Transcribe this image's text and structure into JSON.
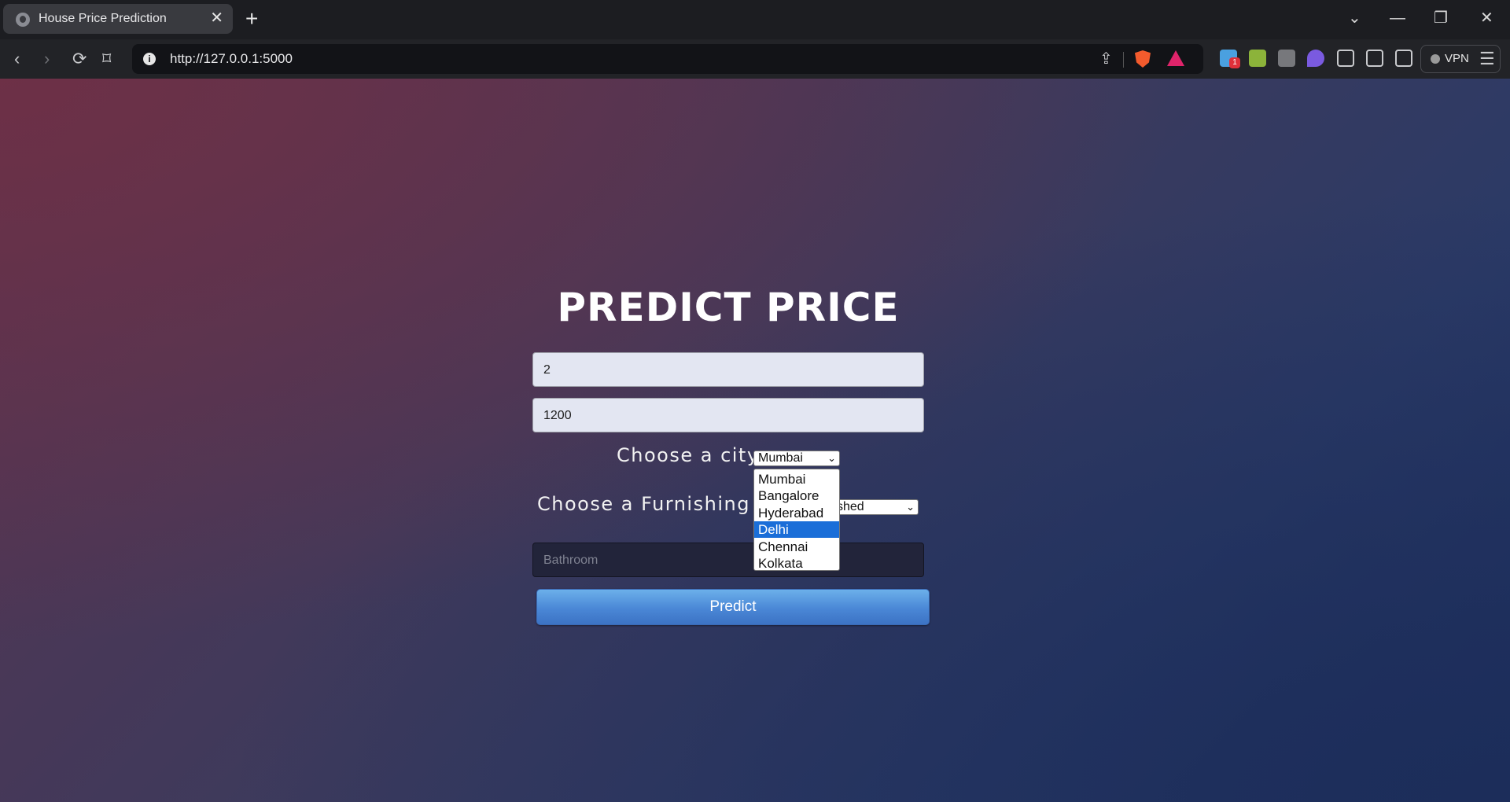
{
  "browser": {
    "tab_title": "House Price Prediction",
    "tab_close": "✕",
    "new_tab": "+",
    "url": "http://127.0.0.1:5000",
    "vpn_label": "VPN",
    "window_controls": [
      "⌄",
      "—",
      "❐",
      "✕"
    ],
    "nav": {
      "back": "‹",
      "forward": "›",
      "reload": "⟳",
      "bookmark": "⌑"
    },
    "extension_badge": "1"
  },
  "page": {
    "heading": "PREDICT PRICE",
    "bhk_value": "2",
    "area_value": "1200",
    "city_label": "Choose a city:",
    "city_selected": "Mumbai",
    "city_options": [
      "Mumbai",
      "Bangalore",
      "Hyderabad",
      "Delhi",
      "Chennai",
      "Kolkata"
    ],
    "city_highlighted": "Delhi",
    "furnishing_label": "Choose a Furnishing St",
    "furnishing_visible": "shed",
    "bathroom_placeholder": "Bathroom",
    "predict_label": "Predict"
  },
  "colors": {
    "accent_button": "#4a87d6",
    "option_highlight": "#1a6ed8",
    "brave_shield": "#f35b2d",
    "brave_rewards": "#e0246b"
  }
}
